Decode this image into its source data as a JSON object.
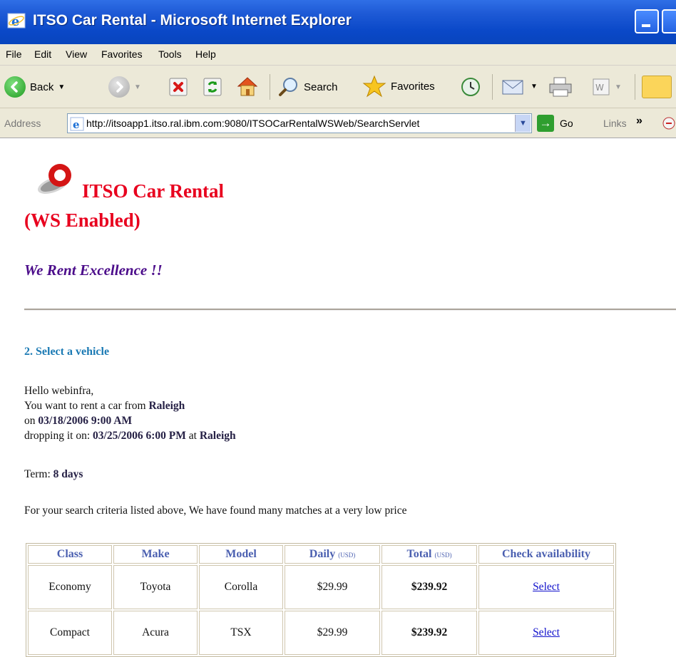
{
  "window": {
    "title": "ITSO Car Rental - Microsoft Internet Explorer"
  },
  "menu": [
    "File",
    "Edit",
    "View",
    "Favorites",
    "Tools",
    "Help"
  ],
  "toolbar": {
    "back": "Back",
    "search": "Search",
    "favorites": "Favorites"
  },
  "address": {
    "label": "Address",
    "url": "http://itsoapp1.itso.ral.ibm.com:9080/ITSOCarRentalWSWeb/SearchServlet",
    "go": "Go",
    "links": "Links",
    "more": "»"
  },
  "page": {
    "brand_line1": "ITSO Car Rental",
    "brand_line2": "(WS Enabled)",
    "motto": "We Rent Excellence !!",
    "step_title": "2. Select a vehicle",
    "greeting": "Hello webinfra,",
    "rent_from_prefix": "You want to rent a car from ",
    "pickup_location": "Raleigh",
    "on_prefix": "on ",
    "pickup_datetime": "03/18/2006 9:00 AM",
    "dropoff_prefix": "dropping it on: ",
    "dropoff_datetime": "03/25/2006 6:00 PM",
    "at_text": " at ",
    "dropoff_location": "Raleigh",
    "term_label": "Term: ",
    "term_value": "8 days",
    "search_message": "For your search criteria listed above, We have found many matches at a very low price"
  },
  "results": {
    "headers": {
      "class": "Class",
      "make": "Make",
      "model": "Model",
      "daily": "Daily",
      "daily_unit": "(USD)",
      "total": "Total",
      "total_unit": "(USD)",
      "check": "Check availability"
    },
    "rows": [
      {
        "class": "Economy",
        "make": "Toyota",
        "model": "Corolla",
        "daily": "$29.99",
        "total": "$239.92",
        "action": "Select"
      },
      {
        "class": "Compact",
        "make": "Acura",
        "model": "TSX",
        "daily": "$29.99",
        "total": "$239.92",
        "action": "Select"
      }
    ]
  }
}
